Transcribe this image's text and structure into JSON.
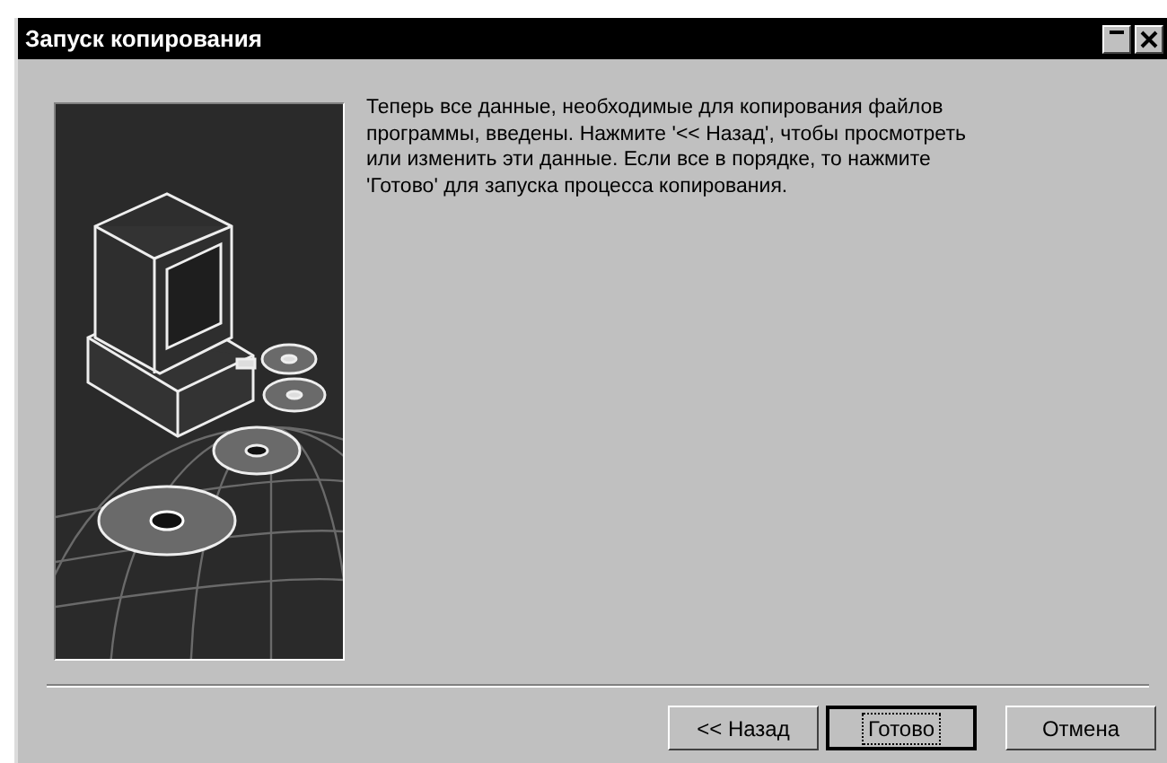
{
  "window": {
    "title": "Запуск копирования"
  },
  "message": {
    "lines": [
      "Теперь все данные, необходимые для копирования файлов",
      "программы, введены. Нажмите '<< Назад', чтобы просмотреть",
      "или изменить эти данные. Если все в порядке, то нажмите",
      "'Готово' для запуска процесса копирования."
    ]
  },
  "buttons": [
    {
      "label": "<< Назад",
      "default": false
    },
    {
      "label": "Готово",
      "default": true
    },
    {
      "label": "Отмена",
      "default": false
    }
  ]
}
